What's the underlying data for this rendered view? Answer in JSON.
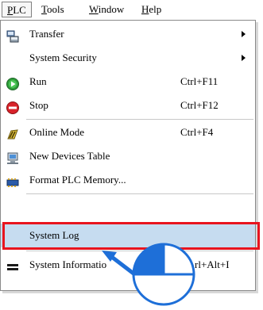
{
  "menubar": {
    "items": [
      {
        "label_pre": "",
        "label_u": "P",
        "label_post": "LC"
      },
      {
        "label_pre": "",
        "label_u": "T",
        "label_post": "ools"
      },
      {
        "label_pre": "",
        "label_u": "W",
        "label_post": "indow"
      },
      {
        "label_pre": "",
        "label_u": "H",
        "label_post": "elp"
      }
    ]
  },
  "dropdown": {
    "items": [
      {
        "label": "Transfer",
        "shortcut": "",
        "icon": "transfer-icon",
        "submenu": true
      },
      {
        "label": "System Security",
        "shortcut": "",
        "icon": "",
        "submenu": true
      },
      {
        "label": "Run",
        "shortcut": "Ctrl+F11",
        "icon": "run-icon",
        "submenu": false
      },
      {
        "label": "Stop",
        "shortcut": "Ctrl+F12",
        "icon": "stop-icon",
        "submenu": false
      },
      {
        "label": "Online Mode",
        "shortcut": "Ctrl+F4",
        "icon": "online-mode-icon",
        "submenu": false
      },
      {
        "label": "New Devices Table",
        "shortcut": "",
        "icon": "devices-table-icon",
        "submenu": false
      },
      {
        "label": "Format PLC Memory...",
        "shortcut": "",
        "icon": "memory-icon",
        "submenu": false
      },
      {
        "label": "System Log",
        "shortcut": "",
        "icon": "",
        "submenu": false,
        "highlighted": true
      },
      {
        "label": "System Informatio",
        "shortcut": "rl+Alt+I",
        "icon": "system-info-icon",
        "submenu": false
      }
    ]
  },
  "colors": {
    "highlight": "#c6dcf0",
    "annotation_frame": "#e8141e",
    "pointer_fill": "#1e6fd8"
  }
}
